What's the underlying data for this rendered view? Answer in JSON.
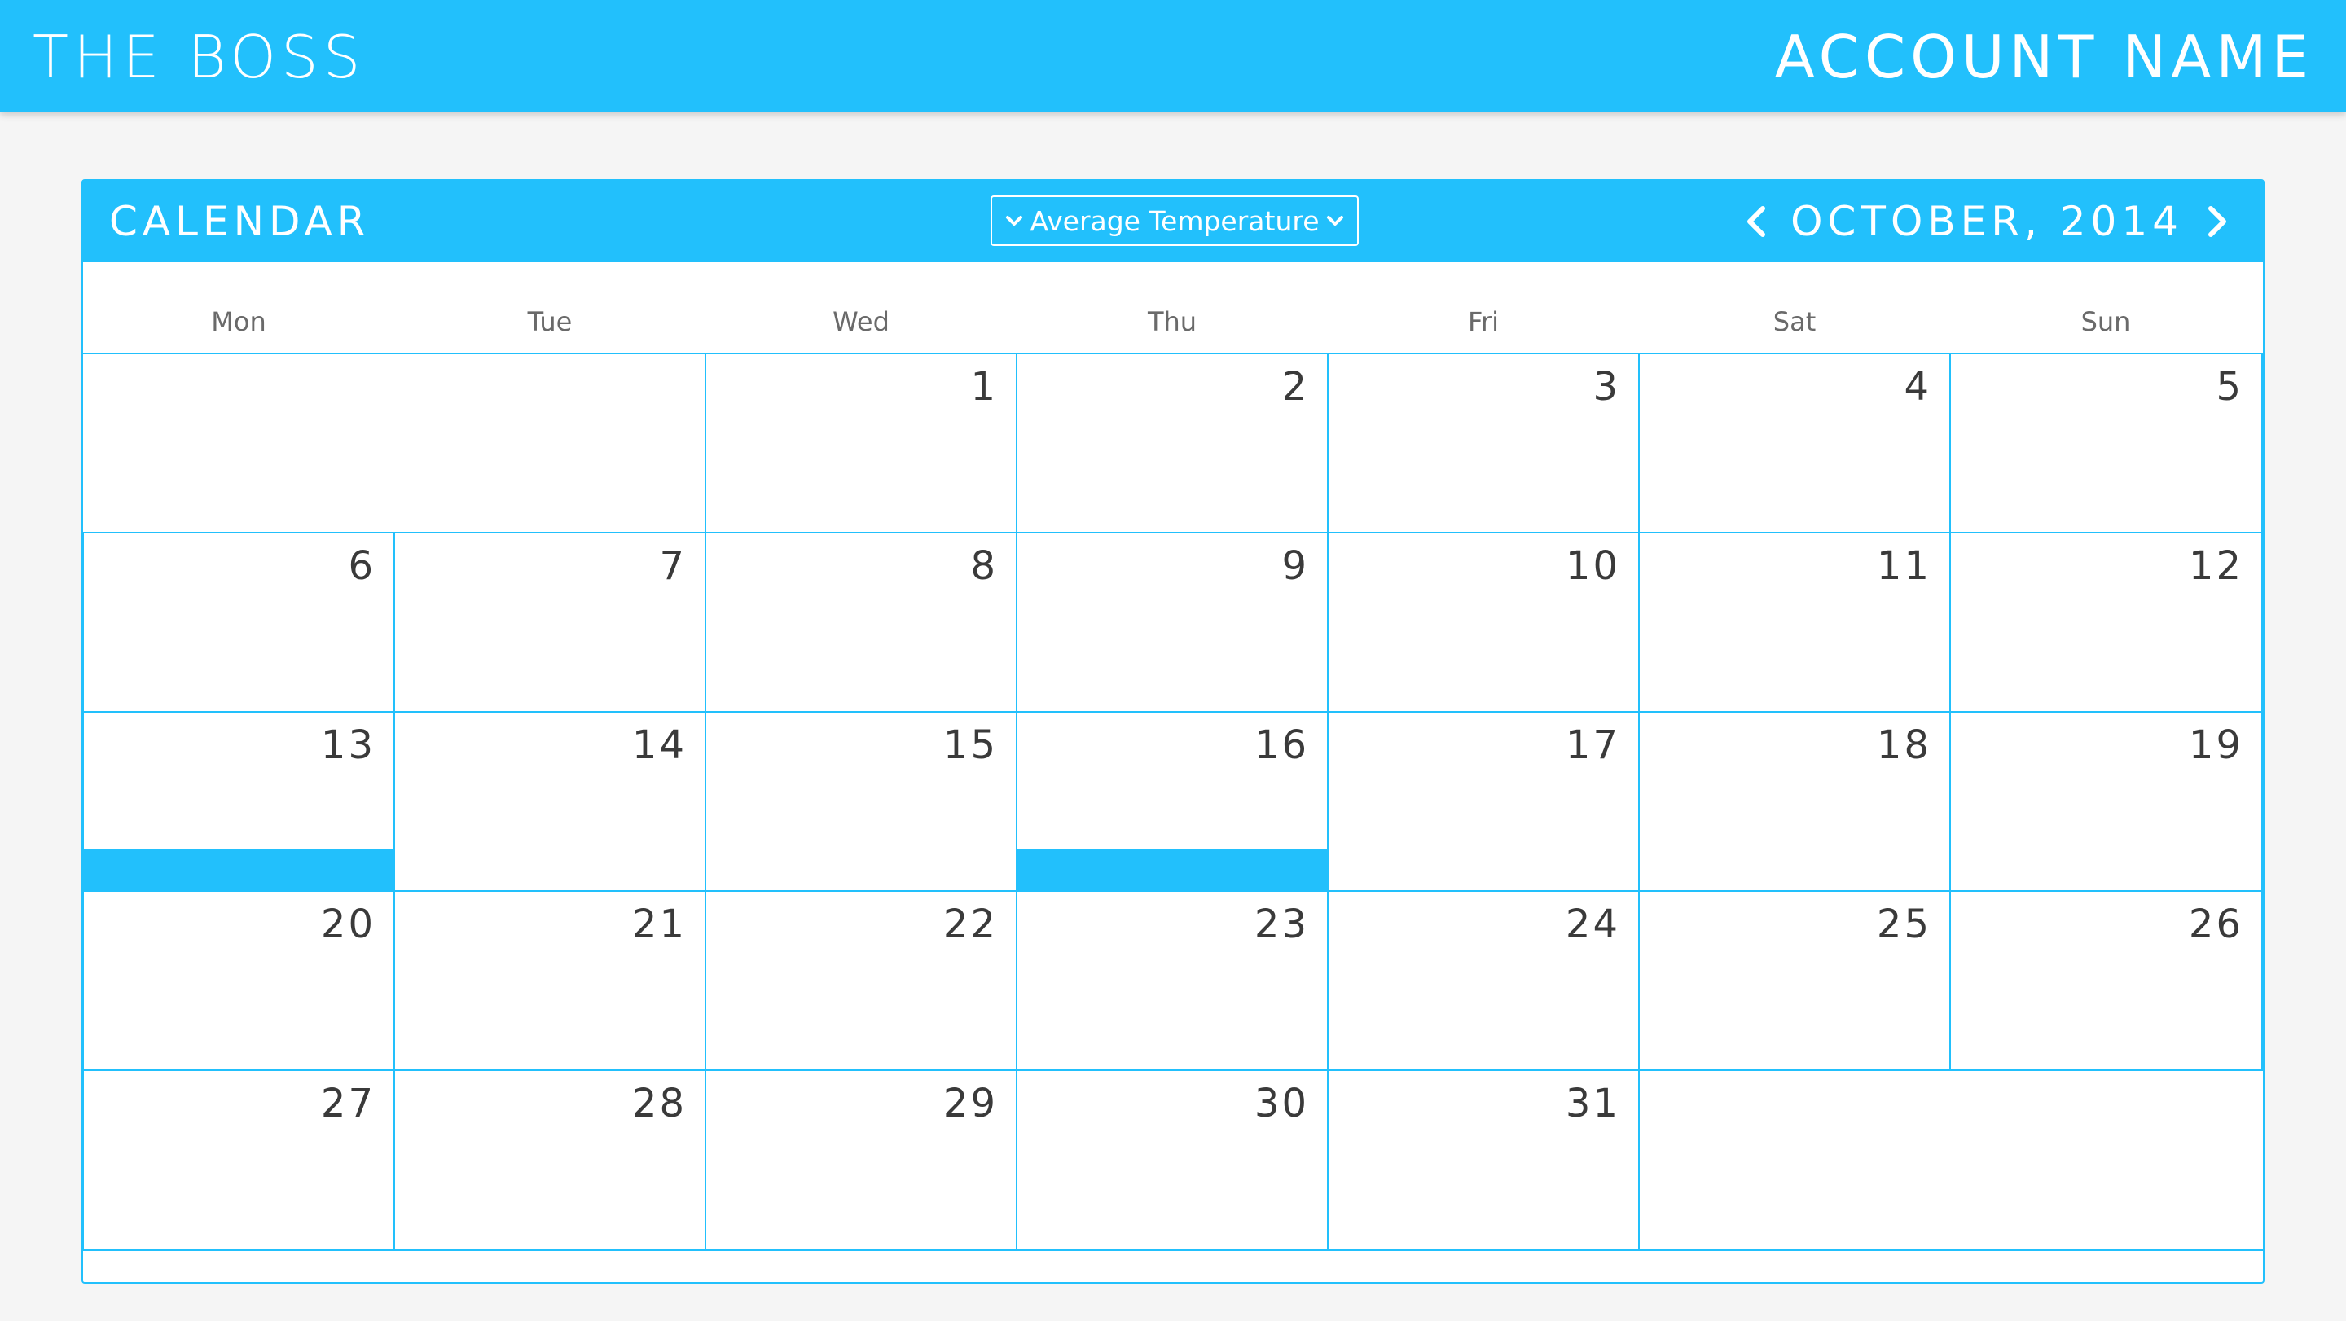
{
  "app": {
    "brand": "THE BOSS",
    "account": "ACCOUNT NAME"
  },
  "calendar": {
    "title": "CALENDAR",
    "metric": "Average Temperature",
    "month_label": "OCTOBER, 2014",
    "weekdays": [
      "Mon",
      "Tue",
      "Wed",
      "Thu",
      "Fri",
      "Sat",
      "Sun"
    ],
    "days": [
      "1",
      "2",
      "3",
      "4",
      "5",
      "6",
      "7",
      "8",
      "9",
      "10",
      "11",
      "12",
      "13",
      "14",
      "15",
      "16",
      "17",
      "18",
      "19",
      "20",
      "21",
      "22",
      "23",
      "24",
      "25",
      "26",
      "27",
      "28",
      "29",
      "30",
      "31"
    ],
    "event_days": [
      "13",
      "16"
    ]
  },
  "colors": {
    "accent": "#22c0fc",
    "background": "#f5f5f5",
    "text": "#3a3a3a"
  }
}
